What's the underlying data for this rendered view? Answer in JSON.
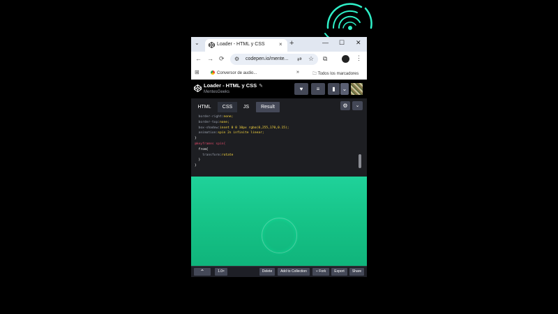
{
  "browser": {
    "tab_title": "Loader - HTML y CSS",
    "tab_close": "×",
    "new_tab": "+",
    "tab_search": "⌄",
    "window_controls": {
      "minimize": "—",
      "maximize": "☐",
      "close": "✕"
    },
    "nav": {
      "back": "←",
      "forward": "→",
      "reload": "⟳"
    },
    "url": "codepen.io/mente...",
    "bookmarks": {
      "item": "Conversor de audio...",
      "more": "»",
      "all": "Todos los marcadores"
    }
  },
  "codepen": {
    "pen_title": "Loader - HTML y CSS",
    "edit_icon": "✎",
    "author": "MentesGeeks",
    "buttons": {
      "heart": "♥",
      "collections": "≡",
      "bookmark": "▮",
      "dropdown": "⌄"
    }
  },
  "editor": {
    "tabs": [
      "HTML",
      "CSS",
      "JS",
      "Result"
    ],
    "active_tab": "CSS",
    "settings_icon": "⚙",
    "collapse_icon": "⌄",
    "code_lines": [
      {
        "prop": "border-right",
        "val": "none;"
      },
      {
        "prop": "border-top",
        "val": "none;"
      },
      {
        "prop": "box-shadow",
        "val": "inset 0 0 10px rgba(0,255,170,0.15);"
      },
      {
        "prop": "animation",
        "val": "spin 2s infinite linear;"
      }
    ],
    "close_brace": "}",
    "keyframes": "@keyframes spin{",
    "from": "from{",
    "transform_prop": "transform",
    "transform_val": "rotate",
    "inner_close": "}"
  },
  "footer": {
    "up": "⌃",
    "zoom": "1.0×",
    "delete": "Delete",
    "add_to_collection": "Add to Collection",
    "fork": "Fork",
    "export": "Export",
    "share": "Share"
  },
  "colors": {
    "preview_bg": "#16c387",
    "editor_bg": "#1d1e22",
    "button_bg": "#444857"
  }
}
